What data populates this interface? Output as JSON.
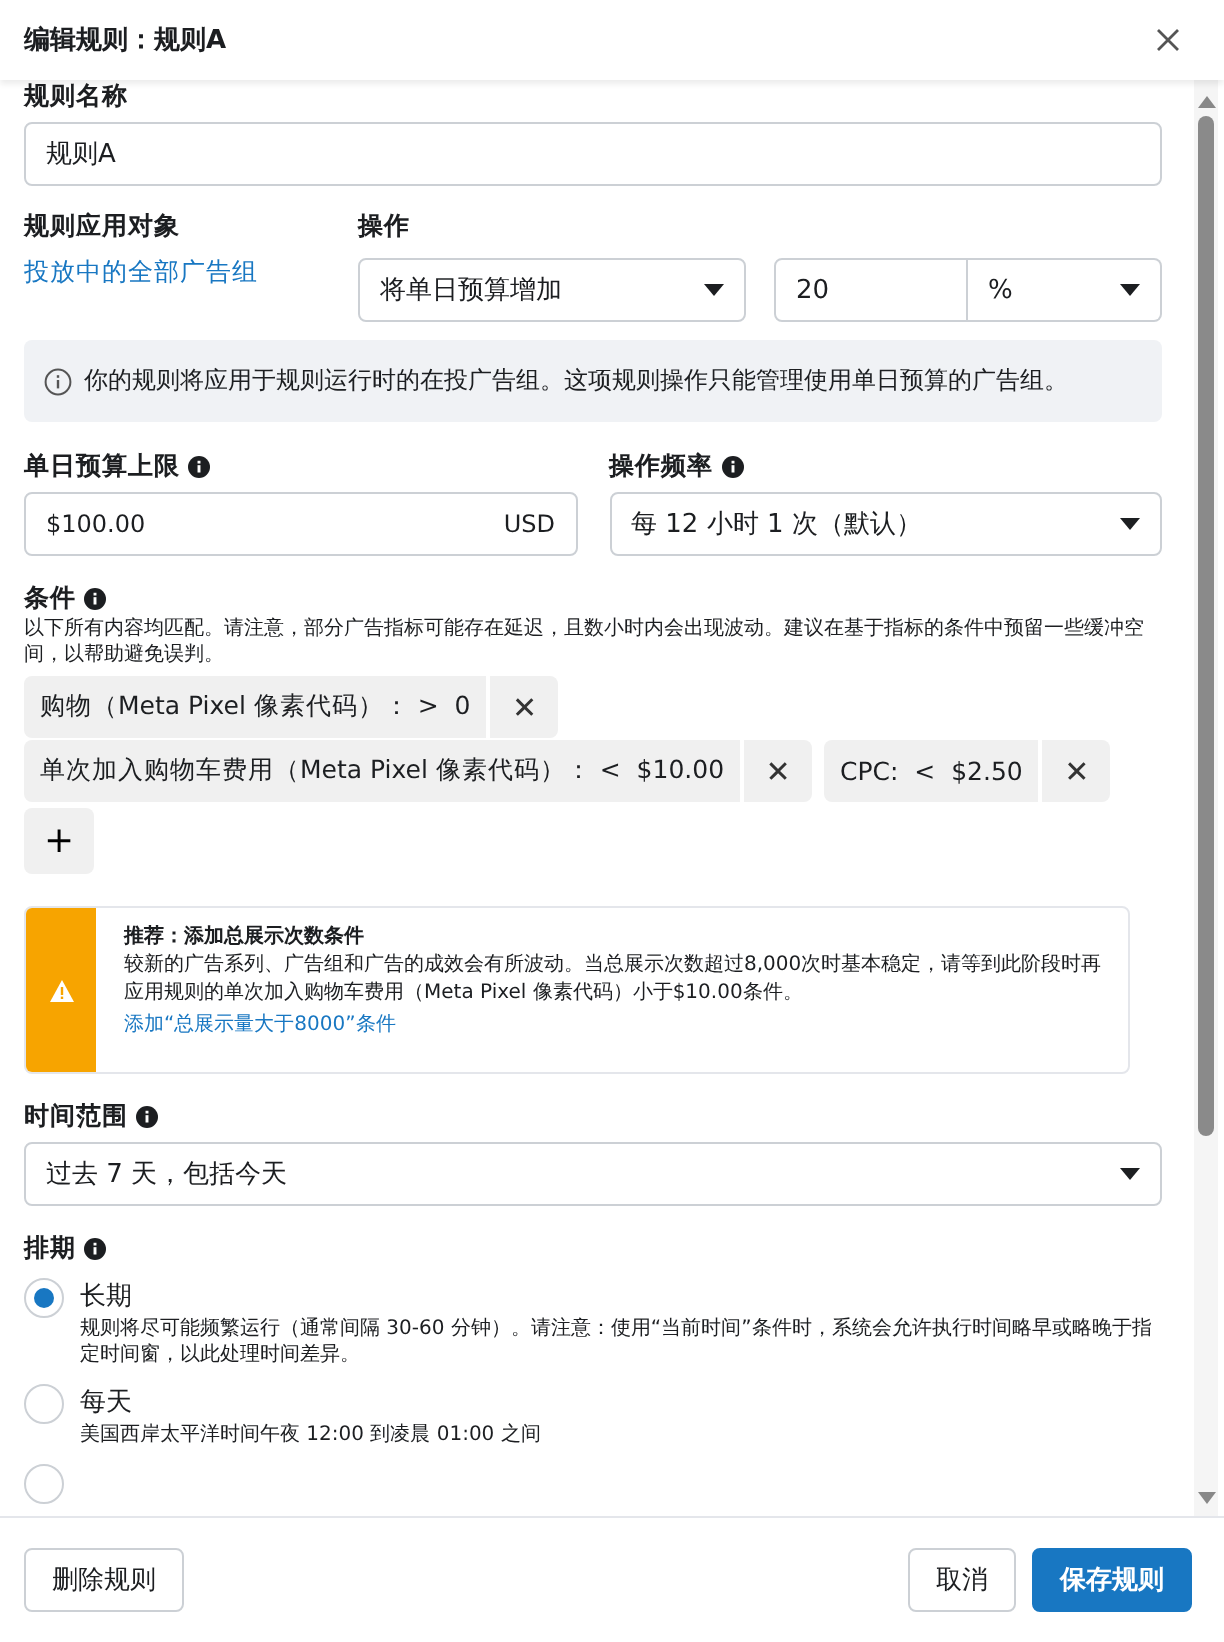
{
  "dialog": {
    "title": "编辑规则：规则A"
  },
  "rule_name": {
    "label": "规则名称",
    "value": "规则A"
  },
  "apply_to": {
    "label": "规则应用对象",
    "link": "投放中的全部广告组"
  },
  "action": {
    "label": "操作",
    "select": "将单日预算增加",
    "amount": "20",
    "unit": "%"
  },
  "info": "你的规则将应用于规则运行时的在投广告组。这项规则操作只能管理使用单日预算的广告组。",
  "budget_cap": {
    "label": "单日预算上限",
    "value": "$100.00",
    "currency": "USD"
  },
  "frequency": {
    "label": "操作频率",
    "value": "每 12 小时 1 次（默认）"
  },
  "conditions": {
    "label": "条件",
    "description": "以下所有内容均匹配。请注意，部分广告指标可能存在延迟，且数小时内会出现波动。建议在基于指标的条件中预留一些缓冲空间，以帮助避免误判。",
    "items": [
      {
        "text": "购物（Meta Pixel 像素代码）： >  0",
        "remove": "✕"
      },
      {
        "text": "单次加入购物车费用（Meta Pixel 像素代码）： <  $10.00",
        "remove": "✕"
      },
      {
        "text": "CPC:  <  $2.50",
        "remove": "✕"
      }
    ],
    "add": "+"
  },
  "recommendation": {
    "title": "推荐：添加总展示次数条件",
    "body": "较新的广告系列、广告组和广告的成效会有所波动。当总展示次数超过8,000次时基本稳定，请等到此阶段时再应用规则的单次加入购物车费用（Meta Pixel 像素代码）小于$10.00条件。",
    "link": "添加“总展示量大于8000”条件"
  },
  "time_range": {
    "label": "时间范围",
    "value": "过去 7 天，包括今天"
  },
  "schedule": {
    "label": "排期",
    "options": [
      {
        "label": "长期",
        "description": "规则将尽可能频繁运行（通常间隔 30-60 分钟）。请注意：使用“当前时间”条件时，系统会允许执行时间略早或略晚于指定时间窗，以此处理时间差异。",
        "selected": true
      },
      {
        "label": "每天",
        "description": "美国西岸太平洋时间午夜 12:00 到凌晨 01:00 之间",
        "selected": false
      },
      {
        "selected": false
      }
    ]
  },
  "footer": {
    "delete": "删除规则",
    "cancel": "取消",
    "save": "保存规则"
  }
}
